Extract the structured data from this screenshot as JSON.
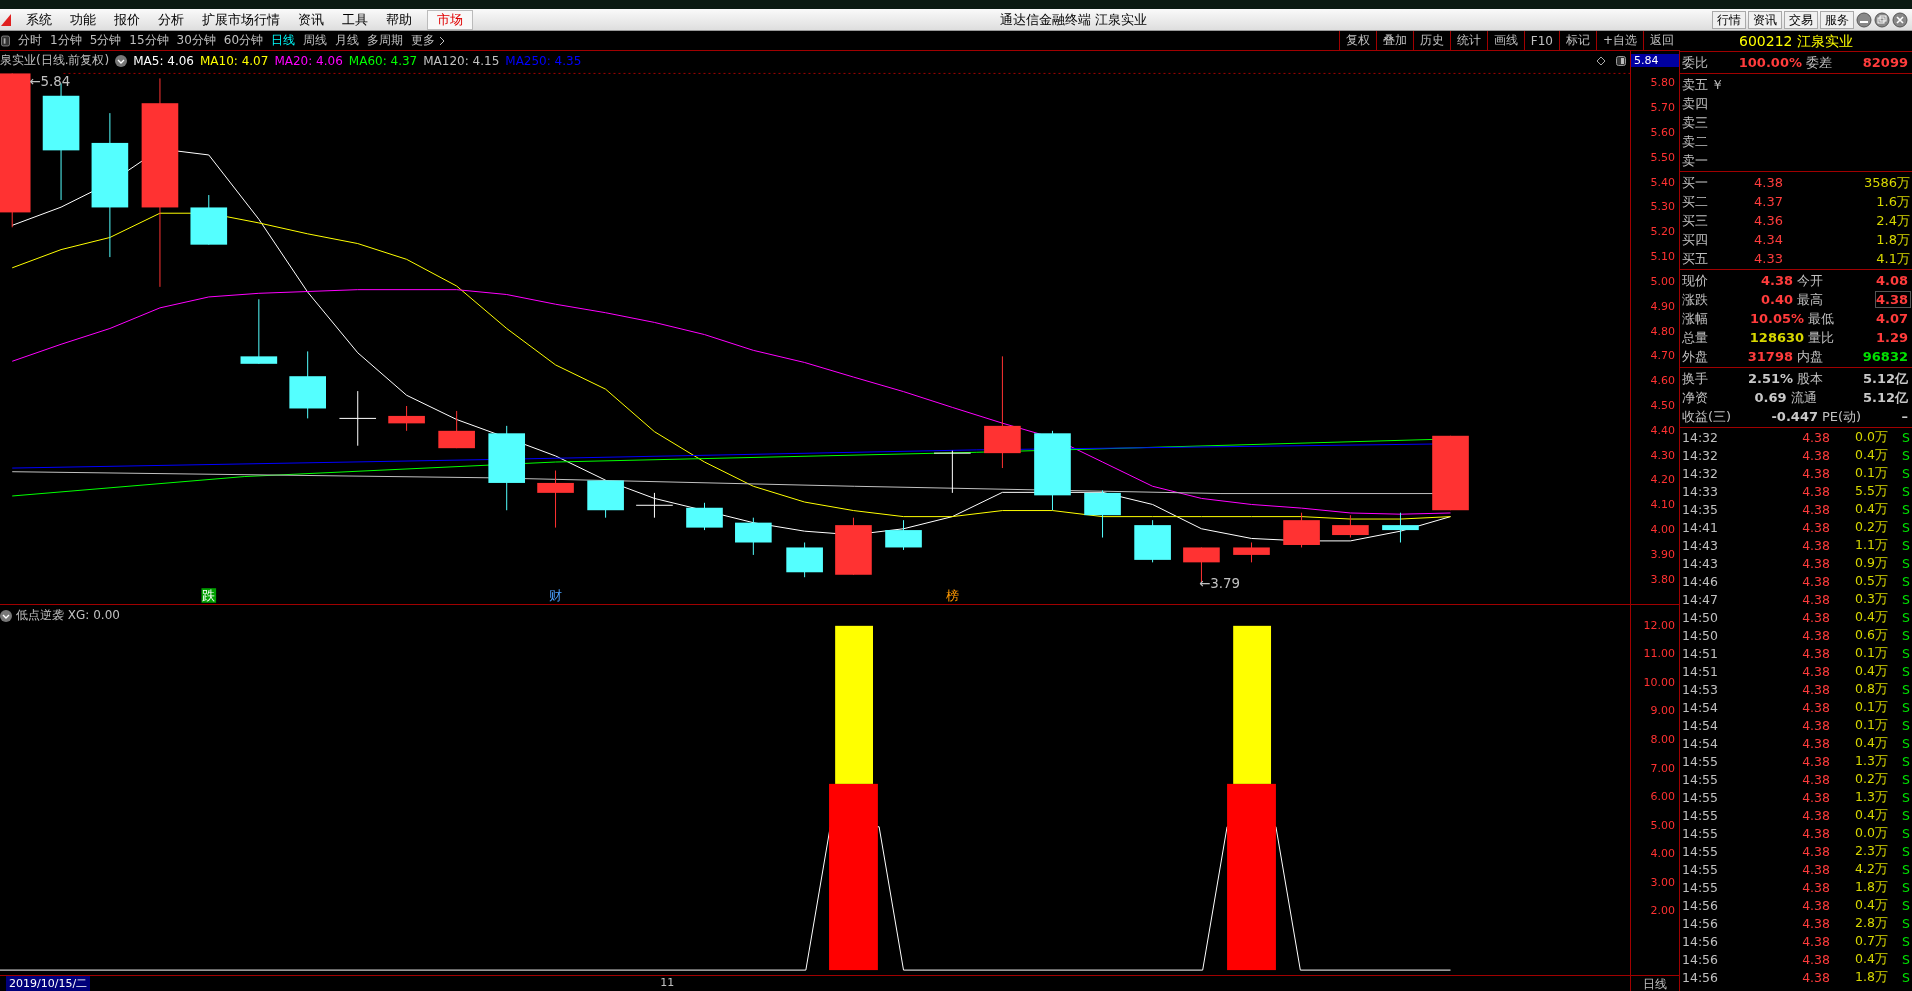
{
  "menu_bar": {
    "items": [
      {
        "label": "系统",
        "selected": false
      },
      {
        "label": "功能",
        "selected": false
      },
      {
        "label": "报价",
        "selected": false
      },
      {
        "label": "分析",
        "selected": false
      },
      {
        "label": "扩展市场行情",
        "selected": false
      },
      {
        "label": "资讯",
        "selected": false
      },
      {
        "label": "工具",
        "selected": false
      },
      {
        "label": "帮助",
        "selected": false
      },
      {
        "label": "市场",
        "selected": true
      }
    ]
  },
  "window": {
    "title": "通达信金融终端 江泉实业",
    "buttons": [
      "行情",
      "资讯",
      "交易",
      "服务"
    ]
  },
  "period_tabs": [
    {
      "label": "分时",
      "selected": false
    },
    {
      "label": "1分钟",
      "selected": false
    },
    {
      "label": "5分钟",
      "selected": false
    },
    {
      "label": "15分钟",
      "selected": false
    },
    {
      "label": "30分钟",
      "selected": false
    },
    {
      "label": "60分钟",
      "selected": false
    },
    {
      "label": "日线",
      "selected": true
    },
    {
      "label": "周线",
      "selected": false
    },
    {
      "label": "月线",
      "selected": false
    },
    {
      "label": "多周期",
      "selected": false
    },
    {
      "label": "更多",
      "selected": false
    }
  ],
  "toolbar": [
    "复权",
    "叠加",
    "历史",
    "统计",
    "画线",
    "F10",
    "标记",
    "+自选",
    "返回"
  ],
  "chart_header": {
    "title": "泉实业(日线.前复权)",
    "indicators": [
      {
        "label": "MA5: 4.06",
        "color": "#ffffff"
      },
      {
        "label": "MA10: 4.07",
        "color": "#ffff00"
      },
      {
        "label": "MA20: 4.06",
        "color": "#ff00ff"
      },
      {
        "label": "MA60: 4.37",
        "color": "#00ff00"
      },
      {
        "label": "MA120: 4.15",
        "color": "#c0c0c0"
      },
      {
        "label": "MA250: 4.35",
        "color": "#0000ff"
      }
    ]
  },
  "price_axis": {
    "current": "5.84",
    "labels": [
      "5.80",
      "5.70",
      "5.60",
      "5.50",
      "5.40",
      "5.30",
      "5.20",
      "5.10",
      "5.00",
      "4.90",
      "4.80",
      "4.70",
      "4.60",
      "4.50",
      "4.40",
      "4.30",
      "4.20",
      "4.10",
      "4.00",
      "3.90",
      "3.80"
    ]
  },
  "price_annotations": {
    "high": "←5.84",
    "low": "←3.79"
  },
  "event_markers": [
    {
      "text": "跌",
      "kind": "badge",
      "color": "#00a000"
    },
    {
      "text": "财",
      "kind": "plain",
      "color": "#4aa0ff"
    },
    {
      "text": "榜",
      "kind": "plain",
      "color": "#ff9900"
    }
  ],
  "indicator_pane": {
    "title": "低点逆袭 XG: 0.00",
    "axis_labels": [
      "12.00",
      "11.00",
      "10.00",
      "9.00",
      "8.00",
      "7.00",
      "6.00",
      "5.00",
      "4.00",
      "3.00",
      "2.00"
    ]
  },
  "date_bar": {
    "date": "2019/10/15/二",
    "month": "11",
    "period": "日线"
  },
  "quote_panel": {
    "title": "600212 江泉实业",
    "ratio": [
      {
        "label": "委比",
        "value": "100.00%",
        "color": "#ff3c3c"
      },
      {
        "label": "委差",
        "value": "82099",
        "color": "#ff3c3c"
      }
    ],
    "asks": [
      {
        "label": "卖五",
        "mark": "￥"
      },
      {
        "label": "卖四"
      },
      {
        "label": "卖三"
      },
      {
        "label": "卖二"
      },
      {
        "label": "卖一"
      }
    ],
    "bids": [
      {
        "label": "买一",
        "price": "4.38",
        "volume": "3586万"
      },
      {
        "label": "买二",
        "price": "4.37",
        "volume": "1.6万"
      },
      {
        "label": "买三",
        "price": "4.36",
        "volume": "2.4万"
      },
      {
        "label": "买四",
        "price": "4.34",
        "volume": "1.8万"
      },
      {
        "label": "买五",
        "price": "4.33",
        "volume": "4.1万"
      }
    ],
    "stats": [
      [
        {
          "label": "现价",
          "value": "4.38",
          "color": "#ff3c3c",
          "highlighted": false
        },
        {
          "label": "今开",
          "value": "4.08",
          "color": "#ff3c3c",
          "highlighted": false
        }
      ],
      [
        {
          "label": "涨跌",
          "value": "0.40",
          "color": "#ff3c3c",
          "highlighted": false
        },
        {
          "label": "最高",
          "value": "4.38",
          "color": "#ff3c3c",
          "highlighted": true
        }
      ],
      [
        {
          "label": "涨幅",
          "value": "10.05%",
          "color": "#ff3c3c",
          "highlighted": false
        },
        {
          "label": "最低",
          "value": "4.07",
          "color": "#ff3c3c",
          "highlighted": false
        }
      ],
      [
        {
          "label": "总量",
          "value": "128630",
          "color": "#d8d800",
          "highlighted": false
        },
        {
          "label": "量比",
          "value": "1.29",
          "color": "#ff3c3c",
          "highlighted": false
        }
      ],
      [
        {
          "label": "外盘",
          "value": "31798",
          "color": "#ff3c3c",
          "highlighted": false
        },
        {
          "label": "内盘",
          "value": "96832",
          "color": "#00e000",
          "highlighted": false
        }
      ]
    ],
    "fundamentals": [
      [
        {
          "label": "换手",
          "value": "2.51%",
          "color": "#c8c8c8",
          "highlighted": false
        },
        {
          "label": "股本",
          "value": "5.12亿",
          "color": "#c8c8c8",
          "highlighted": false
        }
      ],
      [
        {
          "label": "净资",
          "value": "0.69",
          "color": "#c8c8c8",
          "highlighted": false
        },
        {
          "label": "流通",
          "value": "5.12亿",
          "color": "#c8c8c8",
          "highlighted": false
        }
      ],
      [
        {
          "label": "收益(三)",
          "value": "-0.447",
          "color": "#c8c8c8",
          "highlighted": false
        },
        {
          "label": "PE(动)",
          "value": "–",
          "color": "#c8c8c8",
          "highlighted": false
        }
      ]
    ],
    "ticks": [
      {
        "time": "14:32",
        "price": "4.38",
        "volume": "0.0万",
        "side": "S"
      },
      {
        "time": "14:32",
        "price": "4.38",
        "volume": "0.4万",
        "side": "S"
      },
      {
        "time": "14:32",
        "price": "4.38",
        "volume": "0.1万",
        "side": "S"
      },
      {
        "time": "14:33",
        "price": "4.38",
        "volume": "5.5万",
        "side": "S"
      },
      {
        "time": "14:35",
        "price": "4.38",
        "volume": "0.4万",
        "side": "S"
      },
      {
        "time": "14:41",
        "price": "4.38",
        "volume": "0.2万",
        "side": "S"
      },
      {
        "time": "14:43",
        "price": "4.38",
        "volume": "1.1万",
        "side": "S"
      },
      {
        "time": "14:43",
        "price": "4.38",
        "volume": "0.9万",
        "side": "S"
      },
      {
        "time": "14:46",
        "price": "4.38",
        "volume": "0.5万",
        "side": "S"
      },
      {
        "time": "14:47",
        "price": "4.38",
        "volume": "0.3万",
        "side": "S"
      },
      {
        "time": "14:50",
        "price": "4.38",
        "volume": "0.4万",
        "side": "S"
      },
      {
        "time": "14:50",
        "price": "4.38",
        "volume": "0.6万",
        "side": "S"
      },
      {
        "time": "14:51",
        "price": "4.38",
        "volume": "0.1万",
        "side": "S"
      },
      {
        "time": "14:51",
        "price": "4.38",
        "volume": "0.4万",
        "side": "S"
      },
      {
        "time": "14:53",
        "price": "4.38",
        "volume": "0.8万",
        "side": "S"
      },
      {
        "time": "14:54",
        "price": "4.38",
        "volume": "0.1万",
        "side": "S"
      },
      {
        "time": "14:54",
        "price": "4.38",
        "volume": "0.1万",
        "side": "S"
      },
      {
        "time": "14:54",
        "price": "4.38",
        "volume": "0.4万",
        "side": "S"
      },
      {
        "time": "14:55",
        "price": "4.38",
        "volume": "1.3万",
        "side": "S"
      },
      {
        "time": "14:55",
        "price": "4.38",
        "volume": "0.2万",
        "side": "S"
      },
      {
        "time": "14:55",
        "price": "4.38",
        "volume": "1.3万",
        "side": "S"
      },
      {
        "time": "14:55",
        "price": "4.38",
        "volume": "0.4万",
        "side": "S"
      },
      {
        "time": "14:55",
        "price": "4.38",
        "volume": "0.0万",
        "side": "S"
      },
      {
        "time": "14:55",
        "price": "4.38",
        "volume": "2.3万",
        "side": "S"
      },
      {
        "time": "14:55",
        "price": "4.38",
        "volume": "4.2万",
        "side": "S"
      },
      {
        "time": "14:55",
        "price": "4.38",
        "volume": "1.8万",
        "side": "S"
      },
      {
        "time": "14:56",
        "price": "4.38",
        "volume": "0.4万",
        "side": "S"
      },
      {
        "time": "14:56",
        "price": "4.38",
        "volume": "2.8万",
        "side": "S"
      },
      {
        "time": "14:56",
        "price": "4.38",
        "volume": "0.7万",
        "side": "S"
      },
      {
        "time": "14:56",
        "price": "4.38",
        "volume": "0.4万",
        "side": "S"
      },
      {
        "time": "14:56",
        "price": "4.38",
        "volume": "1.8万",
        "side": "S"
      }
    ]
  }
}
